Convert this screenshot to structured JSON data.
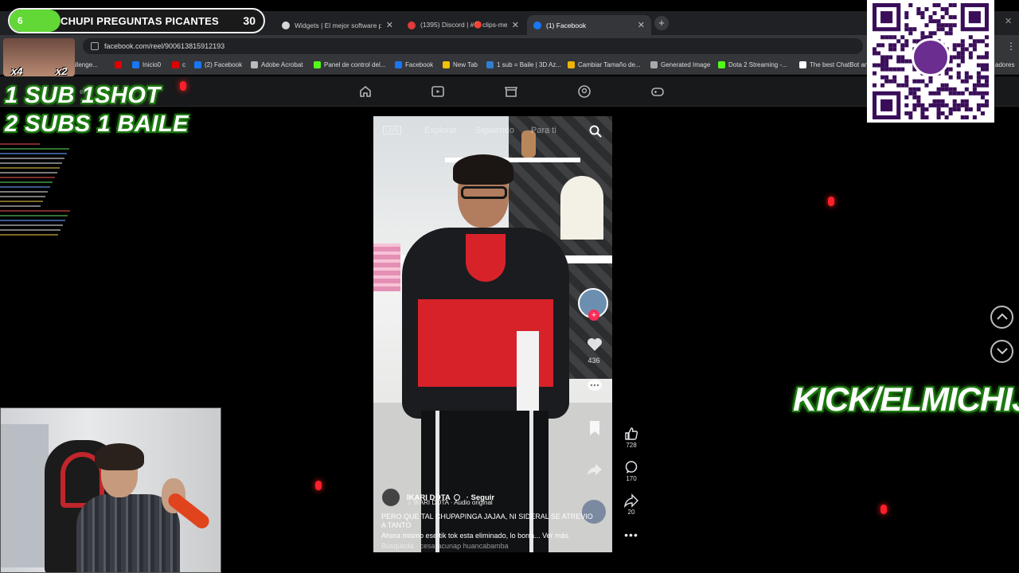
{
  "browser": {
    "tabs": [
      {
        "title": "Widgets | El mejor software pa",
        "active": false,
        "favicon_color": "#d7d7d7"
      },
      {
        "title": "(1395) Discord | #🔴clips-meme",
        "active": false,
        "favicon_color": "#e03b3b"
      },
      {
        "title": "(1) Facebook",
        "active": true,
        "favicon_color": "#1877f2"
      }
    ],
    "new_tab_icon": "plus-icon",
    "url": "facebook.com/reel/900613815912193",
    "bookmarks": [
      {
        "label": "FA__ challenge...",
        "color": "#e04040"
      },
      {
        "label": "",
        "color": "#e00000"
      },
      {
        "label": "Inicio0",
        "color": "#1877f2"
      },
      {
        "label": "c",
        "color": "#e00000"
      },
      {
        "label": "(2) Facebook",
        "color": "#1877f2"
      },
      {
        "label": "Adobe Acrobat",
        "color": "#bbbbbb"
      },
      {
        "label": "Panel de control del...",
        "color": "#53fc18"
      },
      {
        "label": "Facebook",
        "color": "#1877f2"
      },
      {
        "label": "New Tab",
        "color": "#f2c200"
      },
      {
        "label": "1 sub = Baile | 3D Az...",
        "color": "#2f7fd0"
      },
      {
        "label": "Cambiar Tamaño de...",
        "color": "#f0b400"
      },
      {
        "label": "Generated Image",
        "color": "#aaaaaa"
      },
      {
        "label": "Dota 2 Streaming -...",
        "color": "#53fc18"
      },
      {
        "label": "The best ChatBot an",
        "color": "#ffffff"
      },
      {
        "label": "adores",
        "color": "#333333"
      }
    ]
  },
  "facebook": {
    "nav_icons": [
      "home-icon",
      "video-icon",
      "marketplace-icon",
      "groups-icon",
      "gaming-icon"
    ],
    "search_partial": "er"
  },
  "overlay": {
    "goal": {
      "current": "6",
      "title": "CHUPI PREGUNTAS PICANTES",
      "target": "30",
      "progress_fraction": 0.2,
      "fill_color": "#61d836"
    },
    "multipliers": [
      "x4",
      "x2"
    ],
    "promo_line1": "1 SUB 1SHOT",
    "promo_line2": "2 SUBS 1 BAILE",
    "qr_brand": "yape",
    "kick_text": "KICK/ELMICHIJ",
    "accent_color": "#45e21e"
  },
  "reel": {
    "top_tabs": {
      "live": "LIVE",
      "explore": "Explorar",
      "following": "Siguiendo",
      "foryou": "Para ti"
    },
    "tiktok_like_count": "436",
    "author": "IKARI DOTA",
    "follow": "· Seguir",
    "audio": "♫ IKARI DOTA · Audio original",
    "caption": "PERO QUE TAL CHUPAPINGA JAJAA, NI SIDERAL SE ATREVIO A TANTO",
    "caption_more": "Ahora mismo ese tik tok esta eliminado, lo borra... Ver más",
    "search_hint": "Búsqueda · cesaracunap huancabamba",
    "actions": {
      "likes": "728",
      "comments": "170",
      "shares": "20"
    }
  }
}
